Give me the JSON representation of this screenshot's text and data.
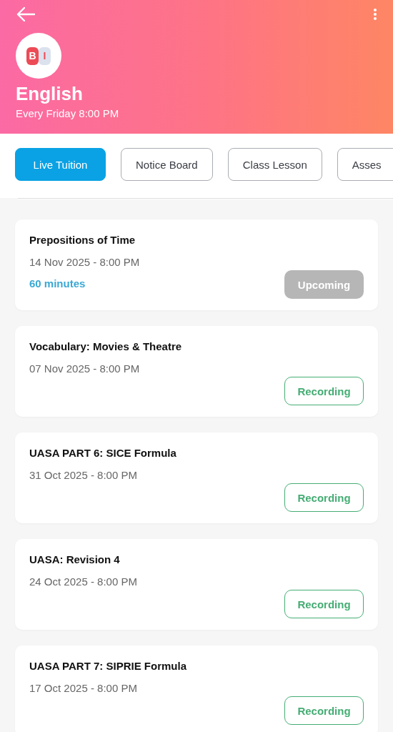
{
  "header": {
    "title": "English",
    "schedule": "Every Friday 8:00 PM",
    "avatar": {
      "letters": [
        "B",
        "I"
      ]
    }
  },
  "tabs": [
    {
      "label": "Live Tuition",
      "selected": true
    },
    {
      "label": "Notice Board",
      "selected": false
    },
    {
      "label": "Class Lesson",
      "selected": false
    },
    {
      "label": "Asses",
      "selected": false
    }
  ],
  "lessons": [
    {
      "title": "Prepositions of Time",
      "date": "14 Nov 2025 - 8:00 PM",
      "duration": "60 minutes",
      "action": {
        "kind": "upcoming",
        "label": "Upcoming"
      }
    },
    {
      "title": "Vocabulary: Movies & Theatre",
      "date": "07 Nov 2025 - 8:00 PM",
      "action": {
        "kind": "recording",
        "label": "Recording"
      }
    },
    {
      "title": "UASA PART 6: SICE Formula",
      "date": "31 Oct 2025 - 8:00 PM",
      "action": {
        "kind": "recording",
        "label": "Recording"
      }
    },
    {
      "title": "UASA: Revision 4",
      "date": "24 Oct 2025 - 8:00 PM",
      "action": {
        "kind": "recording",
        "label": "Recording"
      }
    },
    {
      "title": "UASA PART 7: SIPRIE Formula",
      "date": "17 Oct 2025 - 8:00 PM",
      "action": {
        "kind": "recording",
        "label": "Recording"
      }
    }
  ]
}
